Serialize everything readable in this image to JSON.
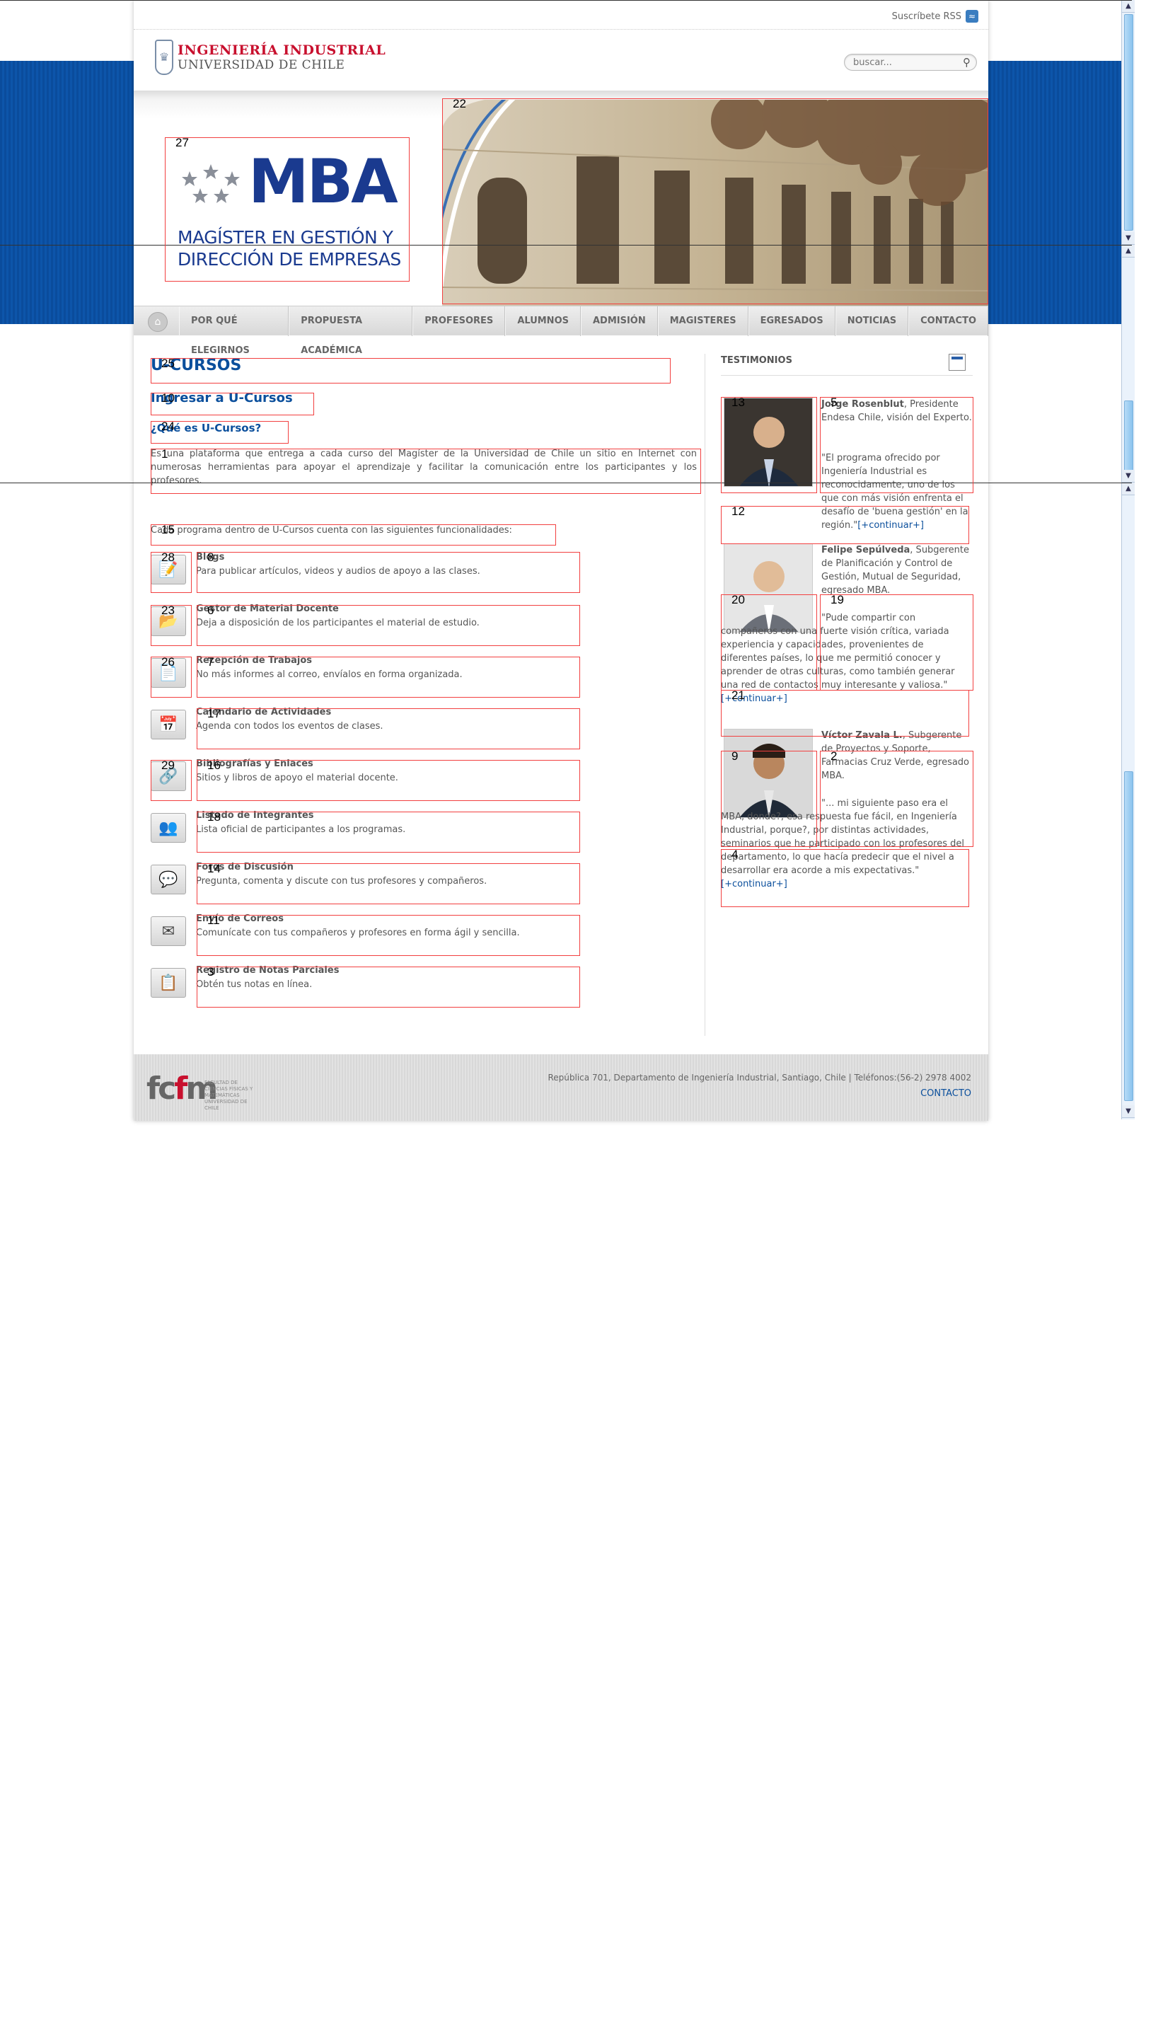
{
  "topbar": {
    "rss_label": "Suscríbete RSS"
  },
  "logo": {
    "line1": "INGENIERÍA INDUSTRIAL",
    "line2": "UNIVERSIDAD DE CHILE"
  },
  "search": {
    "placeholder": "buscar..."
  },
  "hero": {
    "mba": "MBA",
    "subtitle_line1": "MAGÍSTER EN GESTIÓN Y",
    "subtitle_line2": "DIRECCIÓN DE EMPRESAS"
  },
  "nav": {
    "items": [
      "POR QUÉ ELEGIRNOS",
      "PROPUESTA ACADÉMICA",
      "PROFESORES",
      "ALUMNOS",
      "ADMISIÓN",
      "MAGISTERES",
      "EGRESADOS",
      "NOTICIAS",
      "CONTACTO"
    ]
  },
  "main": {
    "title": "U-CURSOS",
    "link": "Ingresar a U-Cursos",
    "subtitle": "¿Qué es U-Cursos?",
    "intro": "Es una plataforma que entrega a cada curso del Magíster de la Universidad de Chile un sitio en Internet con numerosas herramientas para apoyar el aprendizaje y facilitar la comunicación entre los participantes y los profesores.",
    "lead": "Cada programa dentro de U-Cursos cuenta con las siguientes funcionalidades:",
    "features": [
      {
        "title": "Blogs",
        "desc": "Para publicar artículos, videos y audios de apoyo a las clases.",
        "icon": "blog-icon"
      },
      {
        "title": "Gestor de Material Docente",
        "desc": "Deja a disposición de los participantes el material de estudio.",
        "icon": "material-icon"
      },
      {
        "title": "Recepción de Trabajos",
        "desc": "No más informes al correo, envíalos en forma organizada.",
        "icon": "assignment-icon"
      },
      {
        "title": "Calendario de Actividades",
        "desc": "Agenda con todos los eventos de clases.",
        "icon": "calendar-icon"
      },
      {
        "title": "Bibliografías y Enlaces",
        "desc": "Sitios y libros de apoyo el material docente.",
        "icon": "link-icon"
      },
      {
        "title": "Listado de Integrantes",
        "desc": "Lista oficial de participantes a los programas.",
        "icon": "members-icon"
      },
      {
        "title": "Foros de Discusión",
        "desc": "Pregunta, comenta y discute con tus profesores y compañeros.",
        "icon": "forum-icon"
      },
      {
        "title": "Envío de Correos",
        "desc": "Comunícate con tus compañeros y profesores en forma ágil y sencilla.",
        "icon": "mail-icon"
      },
      {
        "title": "Registro de Notas Parciales",
        "desc": "Obtén tus notas en línea.",
        "icon": "grades-icon"
      }
    ]
  },
  "sidebar": {
    "title": "TESTIMONIOS",
    "more": "[+continuar+]",
    "testimonials": [
      {
        "name": "Jorge Rosenblut",
        "role": ", Presidente Endesa Chile, visión del Experto.",
        "quote": "\"El programa ofrecido por Ingeniería Industrial es reconocidamente, uno de los que con más visión enfrenta el desafío de 'buena gestión' en la región.\""
      },
      {
        "name": "Felipe Sepúlveda",
        "role": ", Subgerente de Planificación y Control de Gestión, Mutual de Seguridad, egresado MBA.",
        "quote": "\"Pude compartir con compañeros con una fuerte visión crítica, variada experiencia y capacidades, provenientes de diferentes países, lo que me permitió conocer y aprender de otras culturas, como también generar una red de contactos muy interesante y valiosa.\""
      },
      {
        "name": "Víctor Zavala L.",
        "role": ", Subgerente de Proyectos y Soporte, Farmacias Cruz Verde, egresado MBA.",
        "quote": "\"... mi siguiente paso era el MBA, donde?, esa respuesta fue fácil, en Ingeniería Industrial, porque?, por distintas actividades, seminarios que he participado con los profesores del departamento, lo que hacía predecir que el nivel a desarrollar era acorde a mis expectativas.\""
      }
    ]
  },
  "footer": {
    "brand_f1": "fc",
    "brand_m": "f",
    "brand_f2": "m",
    "brand_small": "FACULTAD DE CIENCIAS FÍSICAS Y MATEMÁTICAS UNIVERSIDAD DE CHILE",
    "address": "República 701, Departamento de Ingeniería Industrial, Santiago, Chile | Teléfonos:(56-2) 2978 4002",
    "contact": "CONTACTO"
  },
  "overlay_labels": [
    "1",
    "2",
    "3",
    "4",
    "5",
    "6",
    "7",
    "8",
    "9",
    "10",
    "11",
    "12",
    "13",
    "14",
    "15",
    "16",
    "17",
    "18",
    "19",
    "20",
    "21",
    "22",
    "23",
    "24",
    "25",
    "26",
    "27",
    "28",
    "29"
  ],
  "colors": {
    "brand_blue": "#0b4f9c",
    "band_blue": "#0a4c9c",
    "accent_red": "#c8102e",
    "overlay_red": "#f24040"
  }
}
